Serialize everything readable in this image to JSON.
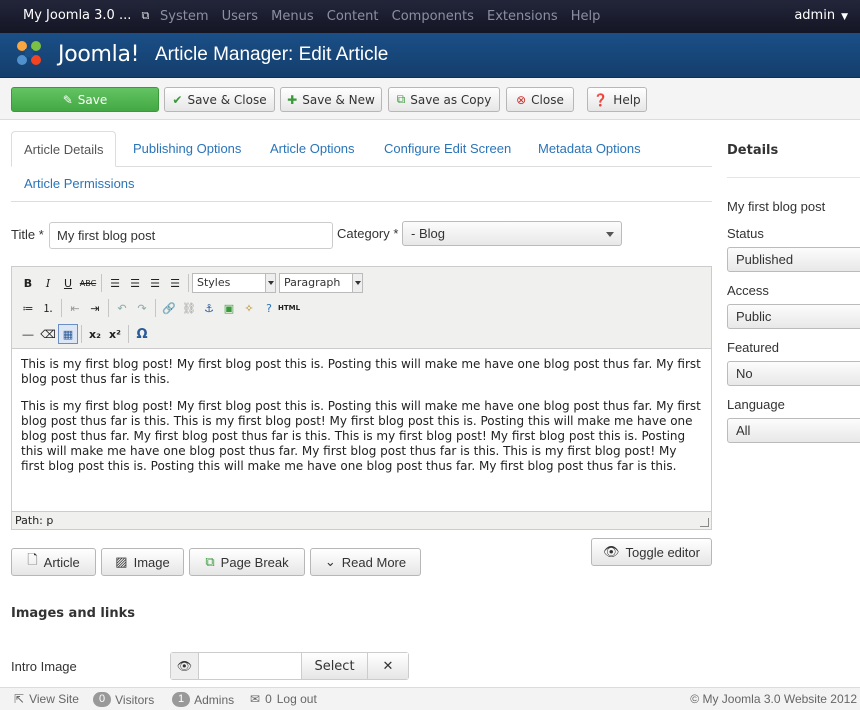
{
  "topbar": {
    "site_name": "My Joomla 3.0 ...",
    "menu": [
      "System",
      "Users",
      "Menus",
      "Content",
      "Components",
      "Extensions",
      "Help"
    ],
    "user": "admin"
  },
  "header": {
    "logo_text": "Joomla!",
    "title": "Article Manager: Edit Article"
  },
  "toolbar": {
    "save": "Save",
    "save_close": "Save & Close",
    "save_new": "Save & New",
    "save_copy": "Save as Copy",
    "close": "Close",
    "help": "Help"
  },
  "tabs": [
    "Article Details",
    "Publishing Options",
    "Article Options",
    "Configure Edit Screen",
    "Metadata Options",
    "Article Permissions"
  ],
  "form": {
    "title_label": "Title *",
    "title_value": "My first blog post",
    "category_label": "Category *",
    "category_value": "- Blog"
  },
  "editor": {
    "styles": "Styles",
    "format": "Paragraph",
    "paragraph1": "This is my first blog post! My first blog post this is. Posting this will make me have one blog post thus far. My first blog post thus far is this.",
    "paragraph2": "This is my first blog post! My first blog post this is. Posting this will make me have one blog post thus far. My first blog post thus far is this. This is my first blog post! My first blog post this is. Posting this will make me have one blog post thus far. My first blog post thus far is this. This is my first blog post! My first blog post this is. Posting this will make me have one blog post thus far. My first blog post thus far is this. This is my first blog post! My first blog post this is. Posting this will make me have one blog post thus far. My first blog post thus far is this.",
    "path": "Path: p",
    "toggle": "Toggle editor"
  },
  "editor_buttons": {
    "article": "Article",
    "image": "Image",
    "page_break": "Page Break",
    "read_more": "Read More"
  },
  "images": {
    "heading": "Images and links",
    "intro_label": "Intro Image",
    "select": "Select"
  },
  "sidebar": {
    "title": "Details",
    "article_name": "My first blog post",
    "status_label": "Status",
    "status_value": "Published",
    "access_label": "Access",
    "access_value": "Public",
    "featured_label": "Featured",
    "featured_value": "No",
    "language_label": "Language",
    "language_value": "All"
  },
  "footer": {
    "view_site": "View Site",
    "visitors_count": "0",
    "visitors_label": "Visitors",
    "admins_count": "1",
    "admins_label": "Admins",
    "logout_count": "0",
    "logout_label": "Log out",
    "copyright": "© My Joomla 3.0 Website 2012"
  }
}
